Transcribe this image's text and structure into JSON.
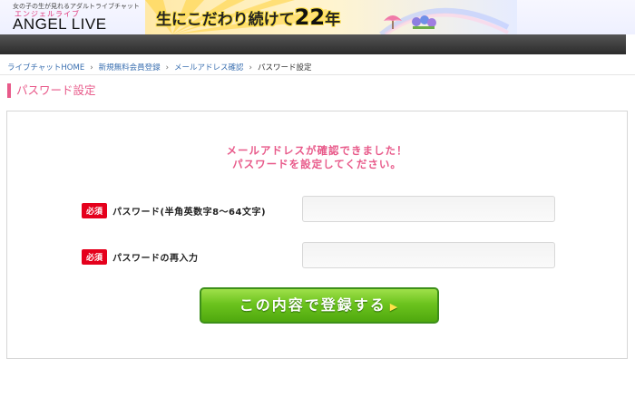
{
  "header": {
    "tagline": "女の子の生が見れるアダルトライブチャット",
    "logo_jp": "エンジェルライブ",
    "logo_en": "ANGEL LIVE",
    "banner_text_pre": "生にこだわり続けて",
    "banner_text_num": "22",
    "banner_text_post": "年"
  },
  "breadcrumb": {
    "items": [
      "ライブチャットHOME",
      "新規無料会員登録",
      "メールアドレス確認",
      "パスワード設定"
    ],
    "separator": "›"
  },
  "page_title": "パスワード設定",
  "form": {
    "message_line1": "メールアドレスが確認できました！",
    "message_line2": "パスワードを設定してください。",
    "required_badge": "必須",
    "password_label": "パスワード(半角英数字8〜64文字)",
    "password_value": "",
    "confirm_label": "パスワードの再入力",
    "confirm_value": "",
    "submit_label": "この内容で登録する",
    "submit_arrow": "▶"
  },
  "colors": {
    "accent_pink": "#e85a8a",
    "required_red": "#e5001c",
    "submit_green": "#6cc31e",
    "link_blue": "#3a6fb0"
  }
}
